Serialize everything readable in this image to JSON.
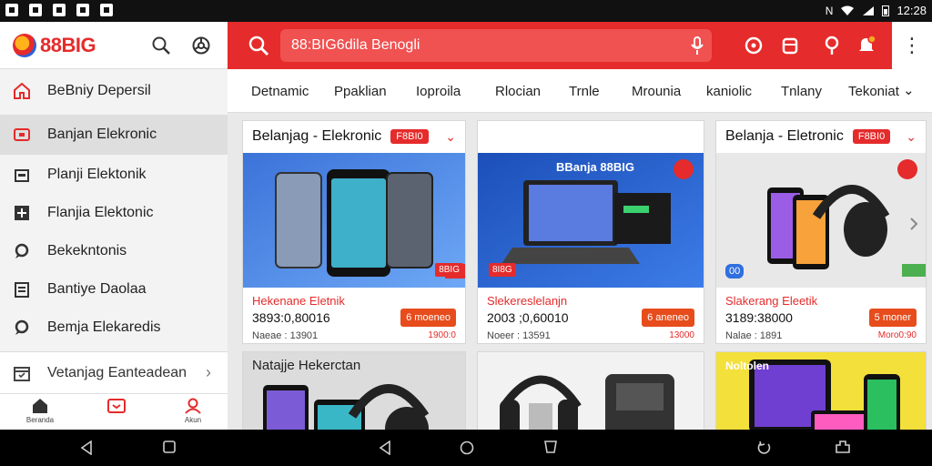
{
  "status_bar": {
    "time": "12:28"
  },
  "sidebar": {
    "brand": "88BIG",
    "items": [
      {
        "label": "BeBniy Depersil",
        "icon": "home-icon",
        "active": false
      },
      {
        "label": "Banjan Elekronic",
        "icon": "tv-icon",
        "active": true
      },
      {
        "label": "Planji Elektonik",
        "icon": "store-icon",
        "active": false
      },
      {
        "label": "Flanjia Elektonic",
        "icon": "plus-icon",
        "active": false
      },
      {
        "label": "Bekekntonis",
        "icon": "chat-icon",
        "active": false
      },
      {
        "label": "Bantiye Daolaa",
        "icon": "clipboard-icon",
        "active": false
      },
      {
        "label": "Bemja Elekaredis",
        "icon": "chat-icon",
        "active": false
      }
    ],
    "bottom_item": {
      "label": "Vetanjag Eanteadean",
      "icon": "calendar-icon"
    },
    "bottom_nav": [
      {
        "label": "Beranda",
        "icon": "home-icon"
      },
      {
        "label": "",
        "icon": "tv-icon"
      },
      {
        "label": "Akun",
        "icon": "user-icon"
      }
    ]
  },
  "topbar": {
    "search_placeholder": "88:BIG6dila Benogli",
    "accent": "#e52b2b"
  },
  "categories": [
    "Detnamic",
    "Ppaklian",
    "Ioproila",
    "Rlocian",
    "Trnle",
    "Mrounia",
    "kaniolic",
    "Tnlany",
    "Tekoniat"
  ],
  "cards": [
    {
      "header": "Belanjag  - Elekronic",
      "badge": "F8BI0",
      "title": "Hekenane Eletnik",
      "price": "3893:0,80016",
      "meta": "Naeae : 13901",
      "sold": "1900:0",
      "button": "6 moeneo",
      "corner_badge": "8BIG"
    },
    {
      "header": "",
      "badge": "",
      "image_text": "BBanja 88BIG",
      "title": "Slekereslelanjn",
      "price": "2003 ;0,60010",
      "meta": "Noeer : 13591",
      "sold": "13000",
      "button": "6 aneneo",
      "corner_badge": "8I8G"
    },
    {
      "header": "Belanja - Eletronic",
      "badge": "F8BI0",
      "title": "Slakerang Eleetik",
      "price": "3189:38000",
      "meta": "Nalae : 1891",
      "sold": "Moro0:90",
      "button": "5 moner",
      "corner_badge": "00"
    },
    {
      "header": "Natajje Hekerctan",
      "badge": ""
    },
    {
      "header": "",
      "badge": ""
    },
    {
      "header": "Noltolen",
      "badge": ""
    }
  ]
}
